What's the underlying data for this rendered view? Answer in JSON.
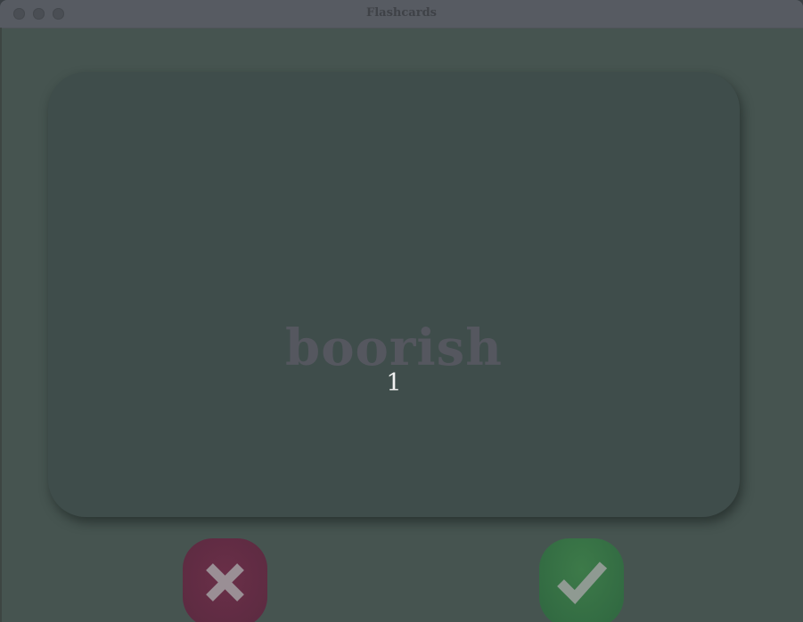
{
  "window": {
    "title": "Flashcards"
  },
  "card": {
    "word": "boorish",
    "counter": "1"
  },
  "buttons": {
    "wrong_icon": "x-mark-icon",
    "right_icon": "checkmark-icon"
  },
  "colors": {
    "background": "#465450",
    "card": "#3f4d4b",
    "word_text": "#55575f",
    "counter_text": "#f2f2f2",
    "wrong_button": "#5e2b43",
    "right_button": "#346e44"
  }
}
